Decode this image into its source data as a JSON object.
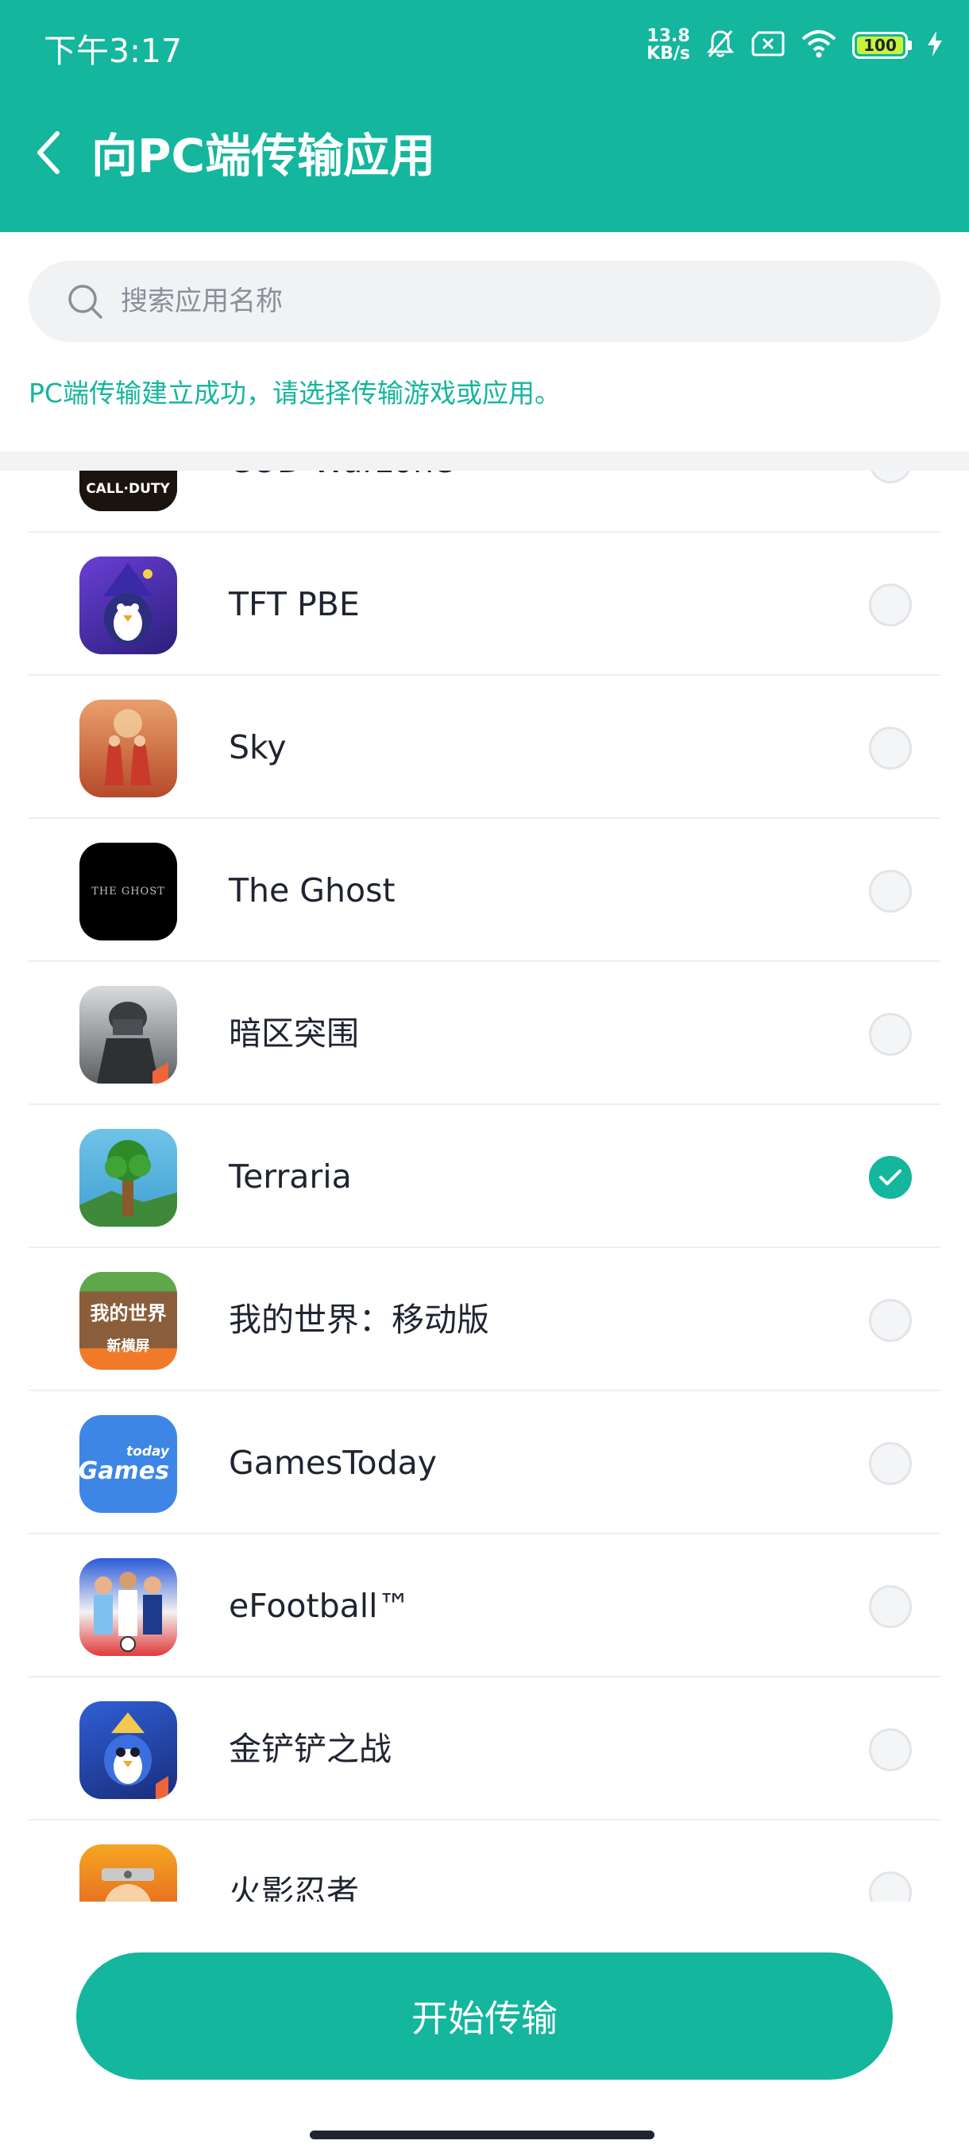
{
  "status_bar": {
    "time": "下午3:17",
    "net_speed_value": "13.8",
    "net_speed_unit": "KB/s",
    "battery": "100",
    "icons": [
      "network-speed",
      "mute-bell-icon",
      "sim-off-icon",
      "wifi-icon",
      "battery-icon",
      "charging-bolt-icon"
    ]
  },
  "header": {
    "title": "向PC端传输应用",
    "back_icon": "chevron-left-icon"
  },
  "search": {
    "placeholder": "搜索应用名称",
    "icon": "search-icon"
  },
  "notice": "PC端传输建立成功，请选择传输游戏或应用。",
  "apps": [
    {
      "name": "COD Warzone",
      "checked": false,
      "icon": "call-of-duty-icon"
    },
    {
      "name": "TFT PBE",
      "checked": false,
      "icon": "tft-pbe-icon"
    },
    {
      "name": "Sky",
      "checked": false,
      "icon": "sky-icon"
    },
    {
      "name": "The Ghost",
      "checked": false,
      "icon": "the-ghost-icon",
      "icon_text": "THE GHOST"
    },
    {
      "name": "暗区突围",
      "checked": false,
      "icon": "arena-breakout-icon"
    },
    {
      "name": "Terraria",
      "checked": true,
      "icon": "terraria-icon"
    },
    {
      "name": "我的世界：移动版",
      "checked": false,
      "icon": "minecraft-icon",
      "icon_text": "我的世界",
      "icon_subtext": "新横屏"
    },
    {
      "name": "GamesToday",
      "checked": false,
      "icon": "gamestoday-icon",
      "icon_text": "Games",
      "icon_subtext": "today"
    },
    {
      "name": "eFootball™",
      "checked": false,
      "icon": "efootball-icon"
    },
    {
      "name": "金铲铲之战",
      "checked": false,
      "icon": "golden-spatula-icon"
    },
    {
      "name": "火影忍者",
      "checked": false,
      "icon": "naruto-icon"
    }
  ],
  "footer": {
    "start_label": "开始传输"
  },
  "colors": {
    "accent": "#14b69d",
    "text": "#1f2430",
    "muted": "#8a8f98"
  }
}
